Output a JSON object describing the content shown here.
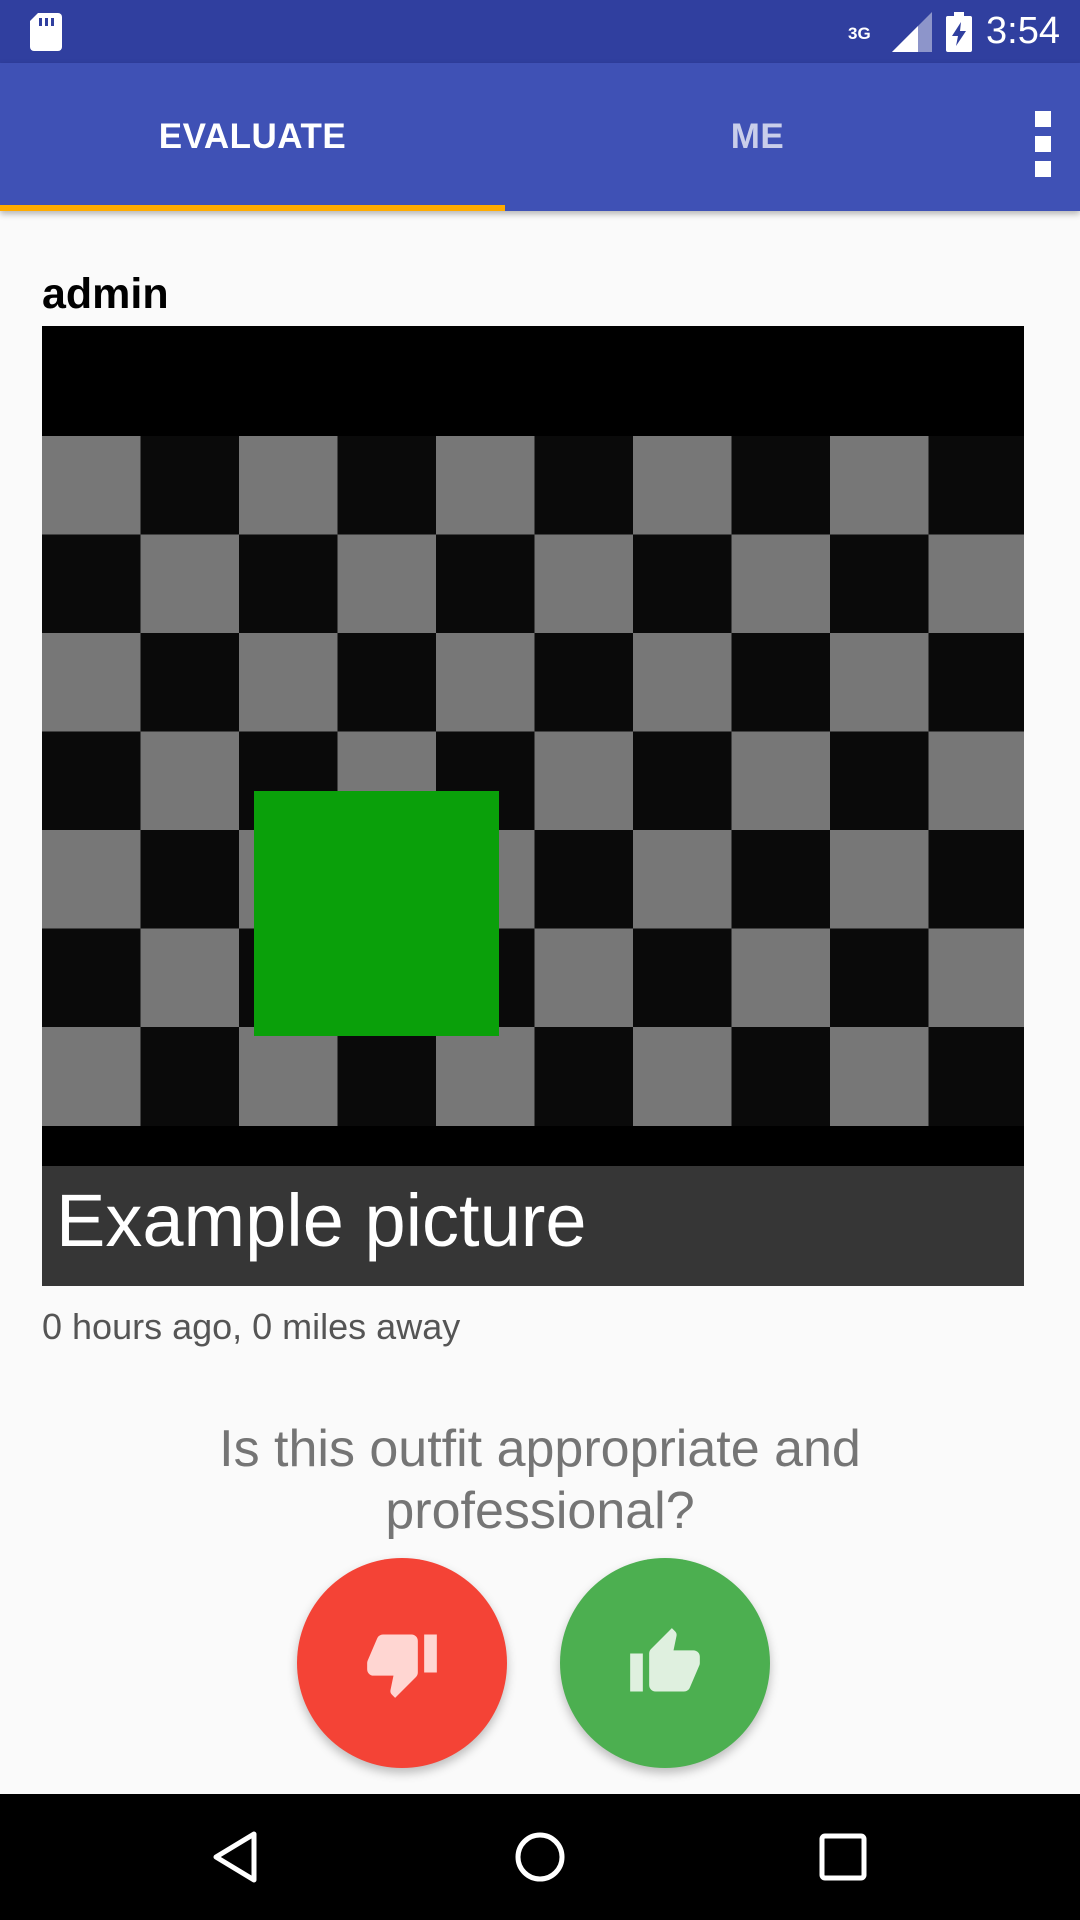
{
  "status_bar": {
    "network_type": "3G",
    "time": "3:54",
    "icons": [
      "sd-card-icon",
      "signal-icon",
      "battery-charging-icon"
    ]
  },
  "tabs": [
    {
      "label": "EVALUATE",
      "selected": true
    },
    {
      "label": "ME",
      "selected": false
    }
  ],
  "overflow_menu_icon": "more-vert-icon",
  "post": {
    "author": "admin",
    "image_caption": "Example picture",
    "meta": "0 hours ago, 0 miles away"
  },
  "question": "Is this outfit appropriate and professional?",
  "actions": {
    "dislike_icon": "thumbs-down-icon",
    "like_icon": "thumbs-up-icon"
  },
  "colors": {
    "status_bar": "#303f9f",
    "app_bar": "#3f51b5",
    "tab_indicator": "#ffab00",
    "dislike": "#f44336",
    "like": "#4caf50"
  },
  "nav_bar": {
    "icons": [
      "back-icon",
      "home-icon",
      "recents-icon"
    ]
  }
}
